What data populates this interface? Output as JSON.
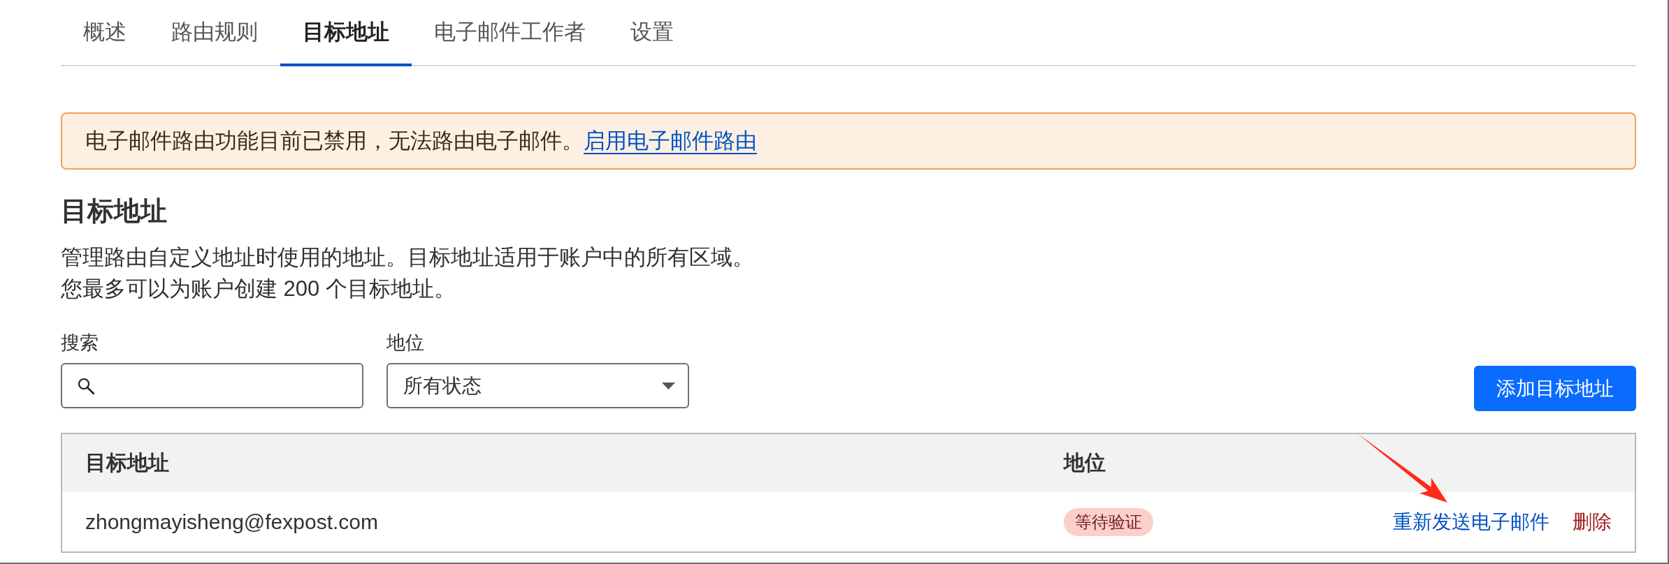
{
  "tabs": [
    {
      "label": "概述",
      "selected": false
    },
    {
      "label": "路由规则",
      "selected": false
    },
    {
      "label": "目标地址",
      "selected": true
    },
    {
      "label": "电子邮件工作者",
      "selected": false
    },
    {
      "label": "设置",
      "selected": false
    }
  ],
  "alert": {
    "message": "电子邮件路由功能目前已禁用，无法路由电子邮件。",
    "link": "启用电子邮件路由"
  },
  "section": {
    "title": "目标地址",
    "description": [
      "管理路由自定义地址时使用的地址。目标地址适用于账户中的所有区域。",
      "您最多可以为账户创建 200 个目标地址。"
    ]
  },
  "filters": {
    "search": {
      "label": "搜索"
    },
    "status": {
      "label": "地位",
      "value": "所有状态"
    }
  },
  "add_button": "添加目标地址",
  "table": {
    "columns": [
      "目标地址",
      "地位"
    ],
    "rows": [
      {
        "address": "zhongmayisheng@fexpost.com",
        "status": "等待验证",
        "actions": [
          {
            "label": "重新发送电子邮件",
            "kind": "link"
          },
          {
            "label": "删除",
            "kind": "danger"
          }
        ]
      }
    ]
  },
  "annotations": [
    {
      "kind": "arrow"
    }
  ]
}
